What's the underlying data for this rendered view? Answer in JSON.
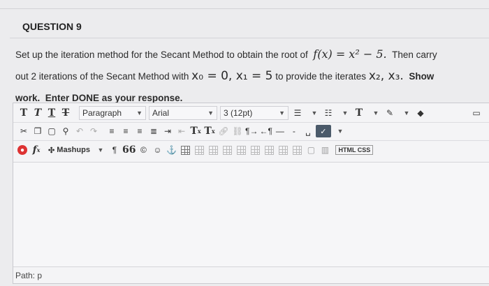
{
  "question": {
    "title": "QUESTION 9",
    "line1_a": "Set up the iteration method for the Secant Method to obtain the root of",
    "fx": "f(x) = x² − 5.",
    "line1_b": "Then carry",
    "line2_a": "out 2 iterations of the Secant Method with",
    "x0": "x₀ = 0, x₁ = 5",
    "line2_b": "to provide the iterates",
    "iterates": "x₂, x₃.",
    "show": "Show",
    "line3_work": "work.",
    "line3_rest": "Enter DONE as your response."
  },
  "toolbar": {
    "t1": "T",
    "t2": "T",
    "t3": "T",
    "t4": "T",
    "paragraph": "Paragraph",
    "font": "Arial",
    "size": "3 (12pt)",
    "superscript": "T",
    "subscript": "T",
    "mashups": "Mashups",
    "quote": "66",
    "copyright": "©",
    "html_css": "HTML CSS",
    "fx": "f",
    "fx_sub": "x"
  },
  "path": {
    "label": "Path: p"
  }
}
